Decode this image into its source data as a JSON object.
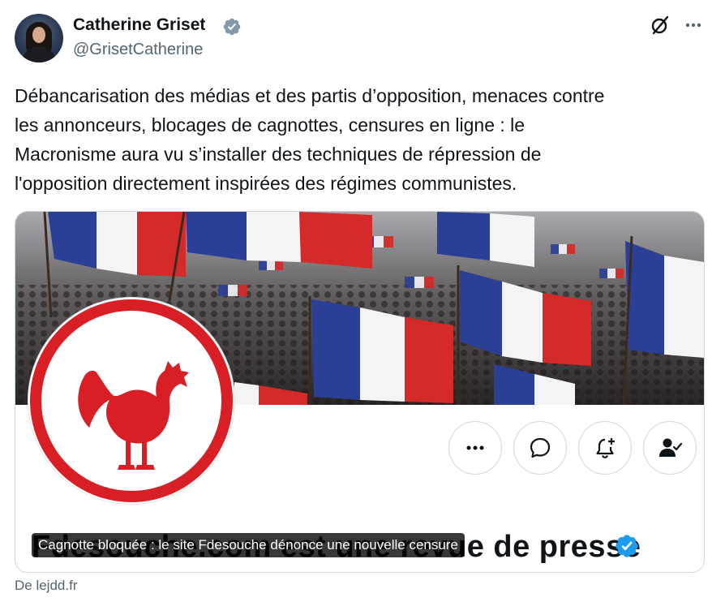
{
  "post": {
    "author": {
      "name": "Catherine Griset",
      "handle": "@GrisetCatherine",
      "verified_color": "#829aab"
    },
    "text": "Débancarisation des médias et des partis d’opposition, menaces contre\nles annonceurs, blocages de cagnottes, censures en ligne : le\nMacronisme aura vu s’installer des techniques de répression de\nl'opposition directement inspirées des régimes communistes.",
    "icons": [
      "grok-icon",
      "more-options-icon"
    ]
  },
  "link_card": {
    "caption": "Cagnotte bloquée : le site Fdesouche dénonce une nouvelle censure",
    "profile_name_visible": "Fdesouche.com est une revue de presse",
    "profile_verified_color": "#1d9bf0",
    "logo_color": "#d81f26",
    "action_buttons": [
      "more-icon",
      "message-icon",
      "notification-add-icon",
      "following-icon"
    ],
    "source": "De lejdd.fr"
  },
  "colors": {
    "text_primary": "#0f1419",
    "text_secondary": "#536471",
    "border": "#cfd9de",
    "flag_blue": "#2b3f96",
    "flag_white": "#f4f4f6",
    "flag_red": "#d52a2a"
  }
}
